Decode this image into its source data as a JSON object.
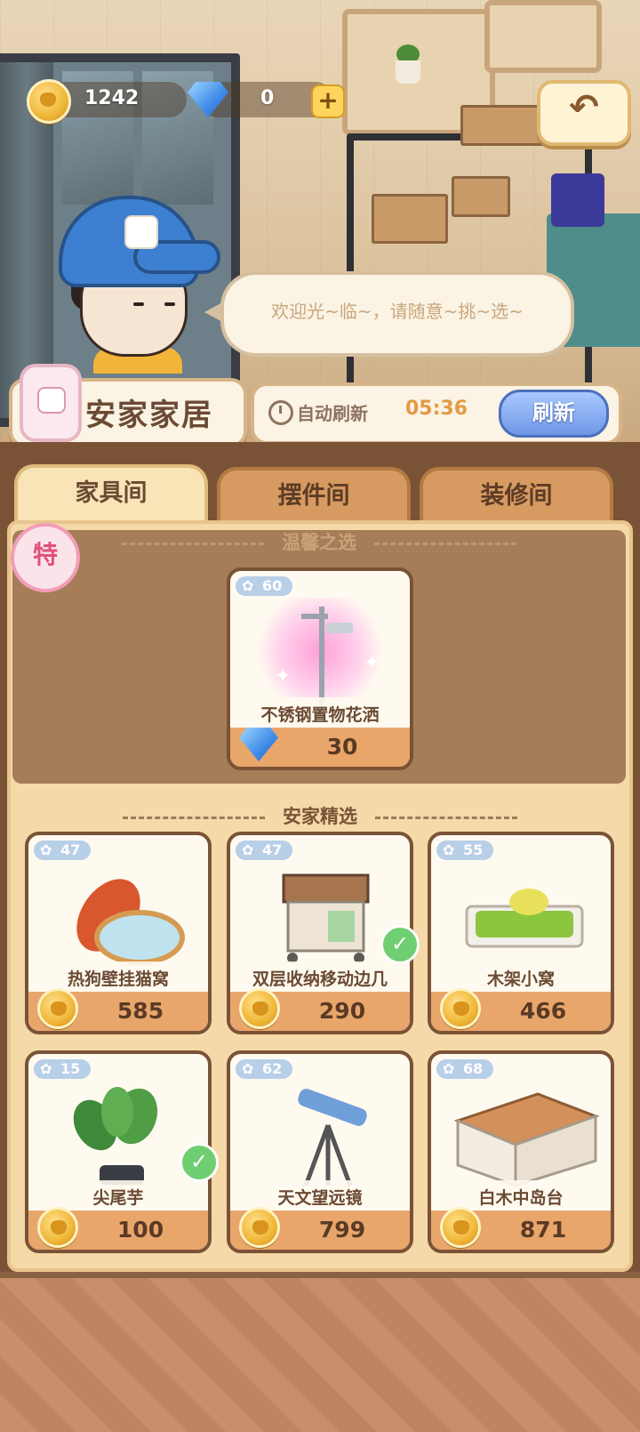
{
  "hud": {
    "coins": "1242",
    "gems": "0",
    "plus_label": "+",
    "back_icon": "↶"
  },
  "npc": {
    "greeting": "欢迎光~临~，请随意~挑~选~"
  },
  "shop": {
    "name": "安家家居"
  },
  "refresh": {
    "label": "自动刷新",
    "countdown": "05:36",
    "button": "刷新"
  },
  "tabs": [
    {
      "label": "家具间",
      "active": true
    },
    {
      "label": "摆件间",
      "active": false
    },
    {
      "label": "装修间",
      "active": false
    }
  ],
  "featured": {
    "title": "温馨之选",
    "badge": "特",
    "item": {
      "level": "60",
      "name": "不锈钢置物花洒",
      "price": "30",
      "currency": "gem"
    }
  },
  "selection": {
    "title": "安家精选",
    "items": [
      {
        "level": "47",
        "name": "热狗壁挂猫窝",
        "price": "585",
        "currency": "coin",
        "owned": false
      },
      {
        "level": "47",
        "name": "双层收纳移动边几",
        "price": "290",
        "currency": "coin",
        "owned": true
      },
      {
        "level": "55",
        "name": "木架小窝",
        "price": "466",
        "currency": "coin",
        "owned": false
      },
      {
        "level": "15",
        "name": "尖尾芋",
        "price": "100",
        "currency": "coin",
        "owned": true
      },
      {
        "level": "62",
        "name": "天文望远镜",
        "price": "799",
        "currency": "coin",
        "owned": false
      },
      {
        "level": "68",
        "name": "白木中岛台",
        "price": "871",
        "currency": "coin",
        "owned": false
      }
    ]
  },
  "check_glyph": "✓"
}
